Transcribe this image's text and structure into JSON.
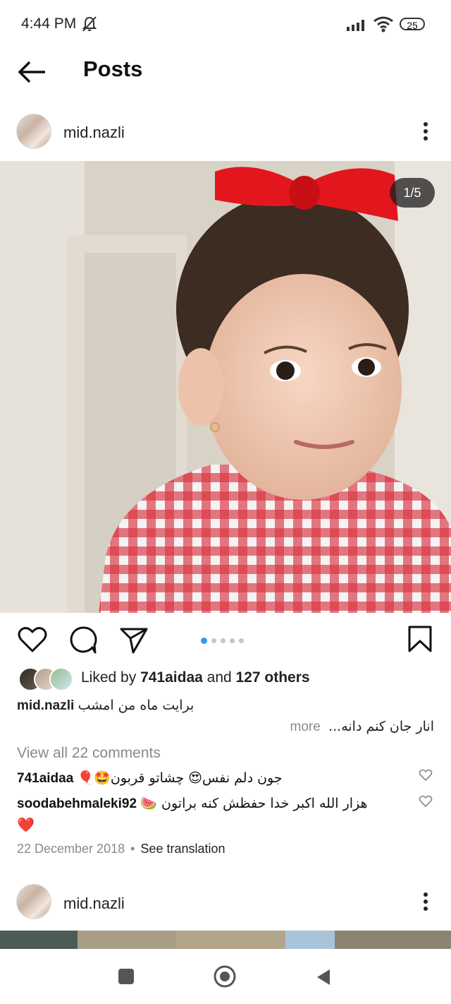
{
  "status_bar": {
    "time": "4:44 PM",
    "battery": "25"
  },
  "app_bar": {
    "title": "Posts"
  },
  "post": {
    "username": "mid.nazli",
    "image_counter": "1/5",
    "carousel": {
      "count": 5,
      "active": 0
    },
    "likes": {
      "prefix": "Liked by ",
      "user": "741aidaa",
      "middle": " and ",
      "others": "127 others"
    },
    "caption_line1": "برایت ماه من امشب",
    "caption_line2": "انار جان کنم دانه...",
    "more_label": "more",
    "view_all": "View all 22 comments",
    "comments": [
      {
        "user": "741aidaa",
        "text": "جون دلم نفس😍 چشاتو قربون🤩🎈"
      },
      {
        "user": "soodabehmaleki92",
        "text": "هزار الله اکبر خدا حفظش کنه براتون 🍉",
        "text2": "❤️"
      }
    ],
    "date": "22 December 2018",
    "separator": "•",
    "see_translation": "See translation"
  },
  "next_post": {
    "username": "mid.nazli"
  },
  "colors": {
    "accent_blue": "#3897f0",
    "text": "#222222",
    "muted": "#8a8a8a"
  }
}
